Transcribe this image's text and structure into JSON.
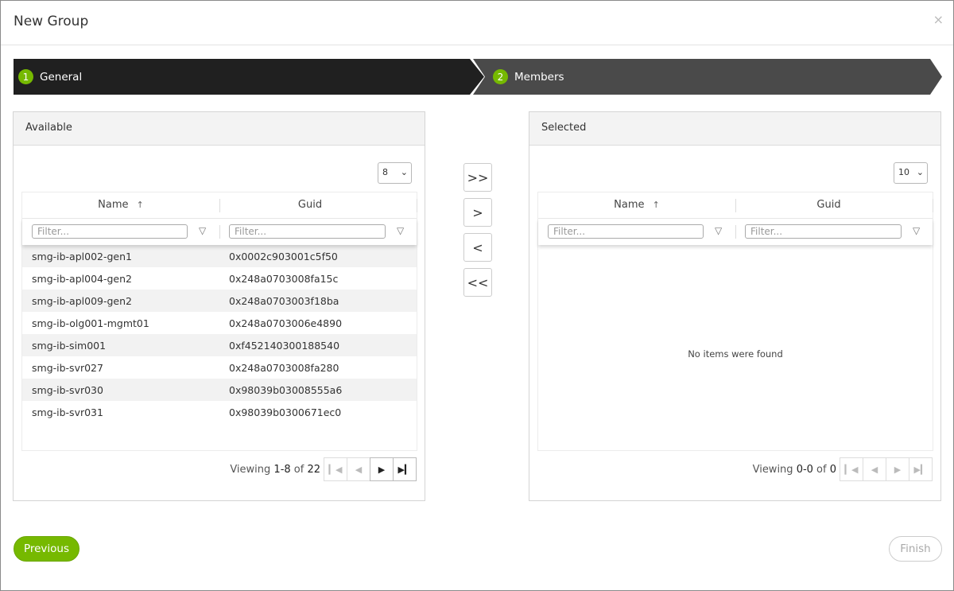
{
  "dialog": {
    "title": "New Group",
    "close": "×"
  },
  "steps": [
    {
      "num": "1",
      "label": "General"
    },
    {
      "num": "2",
      "label": "Members"
    }
  ],
  "available": {
    "title": "Available",
    "page_size": "8",
    "columns": {
      "name": "Name",
      "sort": "↑",
      "guid": "Guid"
    },
    "filter_placeholder": "Filter...",
    "rows": [
      {
        "name": "smg-ib-apl002-gen1",
        "guid": "0x0002c903001c5f50"
      },
      {
        "name": "smg-ib-apl004-gen2",
        "guid": "0x248a0703008fa15c"
      },
      {
        "name": "smg-ib-apl009-gen2",
        "guid": "0x248a0703003f18ba"
      },
      {
        "name": "smg-ib-olg001-mgmt01",
        "guid": "0x248a0703006e4890"
      },
      {
        "name": "smg-ib-sim001",
        "guid": "0xf452140300188540"
      },
      {
        "name": "smg-ib-svr027",
        "guid": "0x248a0703008fa280"
      },
      {
        "name": "smg-ib-svr030",
        "guid": "0x98039b03008555a6"
      },
      {
        "name": "smg-ib-svr031",
        "guid": "0x98039b0300671ec0"
      }
    ],
    "pager": {
      "prefix": "Viewing ",
      "range": "1-8",
      "of": " of ",
      "total": "22"
    }
  },
  "selected": {
    "title": "Selected",
    "page_size": "10",
    "columns": {
      "name": "Name",
      "sort": "↑",
      "guid": "Guid"
    },
    "filter_placeholder": "Filter...",
    "empty_text": "No items were found",
    "pager": {
      "prefix": "Viewing ",
      "range": "0-0",
      "of": " of ",
      "total": "0"
    }
  },
  "transfer": {
    "add_all": ">>",
    "add": ">",
    "remove": "<",
    "remove_all": "<<"
  },
  "footer": {
    "previous": "Previous",
    "finish": "Finish"
  }
}
